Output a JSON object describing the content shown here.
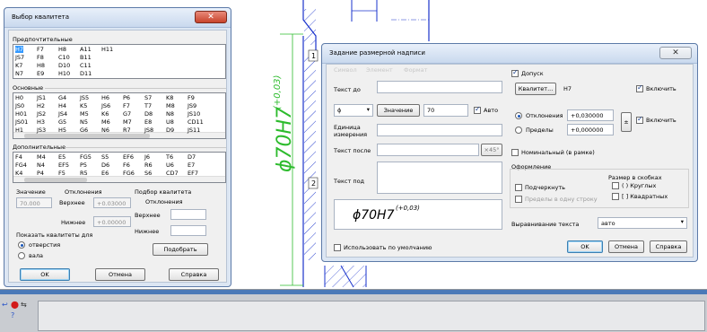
{
  "drawing": {
    "dimension_text": "ϕ70H7",
    "dimension_tolerance": "(+0,03)",
    "markers": [
      "1",
      "2"
    ],
    "colors": {
      "dimension": "#2dbb2d",
      "contour": "#1a33cc"
    }
  },
  "kvalitet_window": {
    "title": "Выбор квалитета",
    "close_icon": "close-icon",
    "preferred": {
      "header": "Предпочтительные",
      "rows": [
        [
          "H7",
          "F7",
          "H8",
          "A11",
          "H11"
        ],
        [
          "JS7",
          "F8",
          "C10",
          "B11",
          ""
        ],
        [
          "K7",
          "H8",
          "D10",
          "C11",
          ""
        ],
        [
          "N7",
          "E9",
          "H10",
          "D11",
          ""
        ]
      ]
    },
    "basic": {
      "header": "Основные",
      "rows": [
        [
          "H0",
          "JS1",
          "G4",
          "JS5",
          "H6",
          "P6",
          "S7",
          "K8",
          "F9"
        ],
        [
          "JS0",
          "H2",
          "H4",
          "K5",
          "JS6",
          "F7",
          "T7",
          "M8",
          "JS9"
        ],
        [
          "H01",
          "JS2",
          "JS4",
          "M5",
          "K6",
          "G7",
          "D8",
          "N8",
          "JS10"
        ],
        [
          "JS01",
          "H3",
          "G5",
          "N5",
          "M6",
          "M7",
          "E8",
          "U8",
          "CD11"
        ],
        [
          "H1",
          "JS3",
          "H5",
          "G6",
          "N6",
          "R7",
          "JS8",
          "D9",
          "JS11"
        ]
      ]
    },
    "additional": {
      "header": "Дополнительные",
      "rows": [
        [
          "F4",
          "M4",
          "E5",
          "FG5",
          "S5",
          "EF6",
          "J6",
          "T6",
          "D7"
        ],
        [
          "FG4",
          "N4",
          "EF5",
          "P5",
          "D6",
          "F6",
          "R6",
          "U6",
          "E7"
        ],
        [
          "K4",
          "P4",
          "F5",
          "R5",
          "E6",
          "FG6",
          "S6",
          "CD7",
          "EF7"
        ]
      ]
    },
    "value_label": "Значение",
    "value": "70.000",
    "deviations_label": "Отклонения",
    "upper_label": "Верхнее",
    "upper_value": "+0.03000",
    "lower_label": "Нижнее",
    "lower_value": "+0.00000",
    "selection_label": "Подбор квалитета",
    "sel_deviations_label": "Отклонения",
    "sel_upper_label": "Верхнее",
    "sel_lower_label": "Нижнее",
    "show_for_label": "Показать квалитеты для",
    "radio_hole": "отверстия",
    "radio_shaft": "вала",
    "pick_button": "Подобрать",
    "ok": "OK",
    "cancel": "Отмена",
    "help": "Справка"
  },
  "inscription_window": {
    "title": "Задание размерной надписи",
    "close_icon": "close-icon",
    "menu": [
      "Символ",
      "Элемент",
      "Формат"
    ],
    "text_before_label": "Текст до",
    "symbol_value": "ϕ",
    "value_button": "Значение",
    "value_field": "70",
    "auto_label": "Авто",
    "unit_label": "Единица измерения",
    "text_after_label": "Текст после",
    "angle_button": "×45°",
    "text_under_label": "Текст под",
    "preview_text": "ϕ70H7",
    "preview_tolerance": "(+0,03)",
    "use_default_label": "Использовать по умолчанию",
    "tolerance_label": "Допуск",
    "kvalitet_button": "Квалитет...",
    "kvalitet_value": "H7",
    "include_label": "Включить",
    "deviations_label": "Отклонения",
    "limits_label": "Пределы",
    "dev_upper": "+0,030000",
    "dev_lower": "+0,000000",
    "plusminus": "±",
    "include_label2": "Включить",
    "nominal_label": "Номинальный (в рамке)",
    "design_label": "Оформление",
    "underline_label": "Подчеркнуть",
    "limits_one_line_label": "Пределы в одну строку",
    "brackets_label": "Размер в скобках",
    "round_label": "( ) Круглых",
    "square_label": "[ ] Квадратных",
    "align_label": "Выравнивание текста",
    "align_value": "авто",
    "ok": "OK",
    "cancel": "Отмена",
    "help": "Справка"
  },
  "bottom_toolbar": {
    "icons": [
      "arrow-icon",
      "stop-icon",
      "format-icon",
      "help-icon"
    ]
  }
}
